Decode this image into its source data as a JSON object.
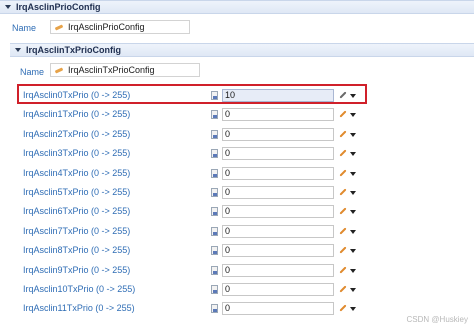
{
  "outer_section": {
    "title": "IrqAsclinPrioConfig"
  },
  "outer_name": {
    "label": "Name",
    "value": "IrqAsclinPrioConfig"
  },
  "inner_section": {
    "title": "IrqAsclinTxPrioConfig"
  },
  "inner_name": {
    "label": "Name",
    "value": "IrqAsclinTxPrioConfig"
  },
  "params": [
    {
      "label": "IrqAsclin0TxPrio (0 -> 255)",
      "value": "10"
    },
    {
      "label": "IrqAsclin1TxPrio (0 -> 255)",
      "value": "0"
    },
    {
      "label": "IrqAsclin2TxPrio (0 -> 255)",
      "value": "0"
    },
    {
      "label": "IrqAsclin3TxPrio (0 -> 255)",
      "value": "0"
    },
    {
      "label": "IrqAsclin4TxPrio (0 -> 255)",
      "value": "0"
    },
    {
      "label": "IrqAsclin5TxPrio (0 -> 255)",
      "value": "0"
    },
    {
      "label": "IrqAsclin6TxPrio (0 -> 255)",
      "value": "0"
    },
    {
      "label": "IrqAsclin7TxPrio (0 -> 255)",
      "value": "0"
    },
    {
      "label": "IrqAsclin8TxPrio (0 -> 255)",
      "value": "0"
    },
    {
      "label": "IrqAsclin9TxPrio (0 -> 255)",
      "value": "0"
    },
    {
      "label": "IrqAsclin10TxPrio (0 -> 255)",
      "value": "0"
    },
    {
      "label": "IrqAsclin11TxPrio (0 -> 255)",
      "value": "0"
    }
  ],
  "watermark": "CSDN @Huskiey",
  "colors": {
    "label_blue": "#2f6db5",
    "highlight_red": "#d0202a",
    "header_bg": "#dfe8f5"
  },
  "icons": {
    "section_toggle": "triangle-down-icon",
    "param_type": "document-icon",
    "edit": "pencil-icon",
    "dropdown": "caret-down-icon"
  }
}
